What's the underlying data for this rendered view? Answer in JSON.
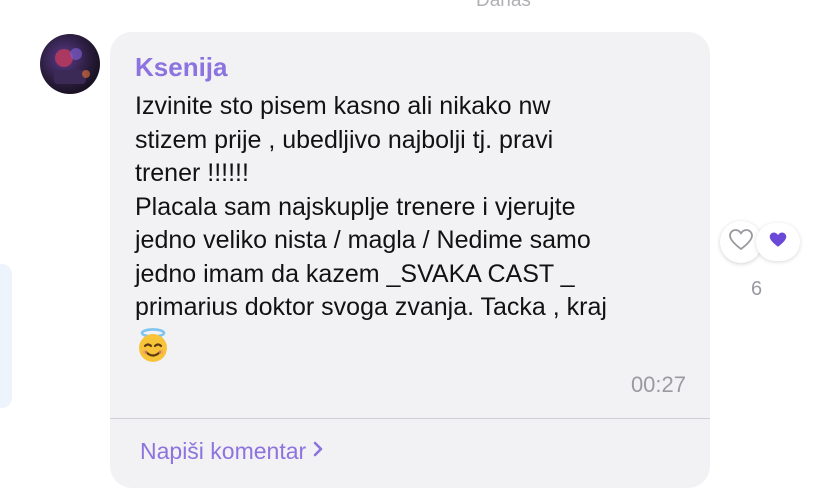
{
  "header": {
    "date_label": "Danas"
  },
  "message": {
    "sender": "Ksenija",
    "text": "Izvinite sto pisem kasno ali nikako nw\nstizem prije , ubedljivo najbolji tj. pravi\ntrener !!!!!!\nPlacala sam najskuplje trenere i vjerujte\njedno veliko nista / magla / Nedime samo\njedno imam da kazem _SVAKA CAST _\nprimarius doktor svoga zvanja. Tacka , kraj",
    "emoji": "smiling-face-with-halo",
    "time": "00:27",
    "comment_label": "Napiši komentar"
  },
  "reactions": {
    "like_icon": "heart-outline-icon",
    "active_icon": "heart-filled-icon",
    "count": "6"
  },
  "colors": {
    "accent": "#8c73df",
    "bubble": "#f2f2f4",
    "muted": "#9a9aa0"
  }
}
